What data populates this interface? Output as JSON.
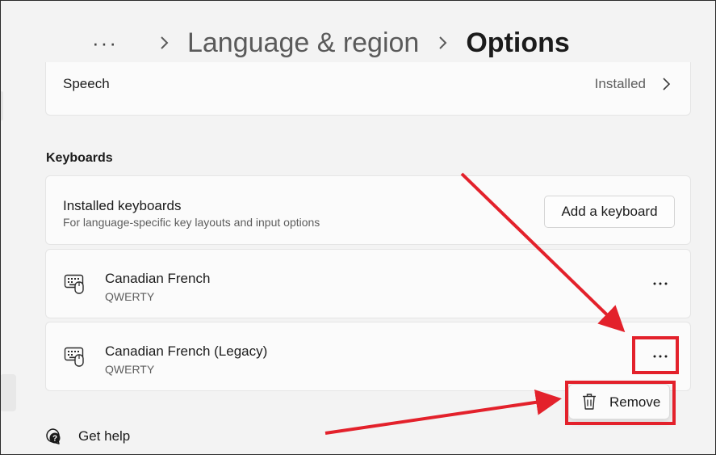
{
  "breadcrumb": {
    "ellipsis": "···",
    "parent": "Language & region",
    "current": "Options"
  },
  "speech": {
    "label": "Speech",
    "status": "Installed"
  },
  "keyboards": {
    "section_title": "Keyboards",
    "installed_title": "Installed keyboards",
    "installed_subtitle": "For language-specific key layouts and input options",
    "add_button_label": "Add a keyboard",
    "items": [
      {
        "name": "Canadian French",
        "layout": "QWERTY"
      },
      {
        "name": "Canadian French (Legacy)",
        "layout": "QWERTY"
      }
    ]
  },
  "context_menu": {
    "remove_label": "Remove"
  },
  "help": {
    "label": "Get help"
  },
  "colors": {
    "annotation": "#e3212b",
    "background": "#f3f3f3",
    "card": "#fbfbfb"
  },
  "icons": {
    "more": "more-horizontal-icon",
    "keyboard": "keyboard-icon",
    "trash": "trash-icon",
    "help": "help-chat-icon",
    "chevron": "chevron-right-icon"
  }
}
